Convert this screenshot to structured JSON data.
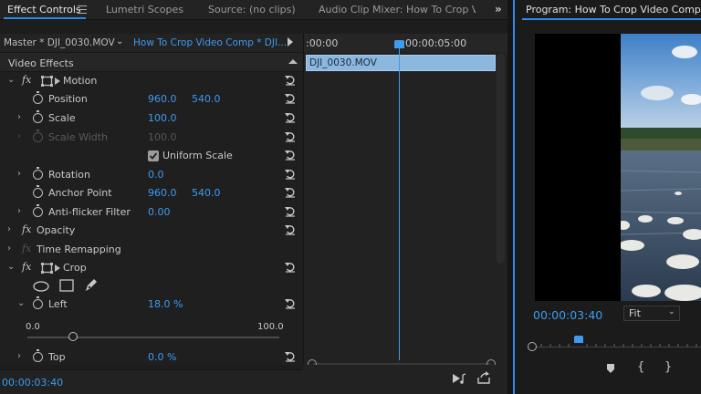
{
  "tabs": [
    {
      "label": "Effect Controls",
      "active": true
    },
    {
      "label": "Lumetri Scopes",
      "active": false
    },
    {
      "label": "Source: (no clips)",
      "active": false
    },
    {
      "label": "Audio Clip Mixer: How To Crop Video",
      "active": false
    }
  ],
  "source_row": {
    "master": "Master * DJI_0030.MOV",
    "sequence": "How To Crop Video Comp * DJI..."
  },
  "effects": {
    "header": "Video Effects",
    "motion": {
      "label": "Motion",
      "position": {
        "label": "Position",
        "x": "960.0",
        "y": "540.0"
      },
      "scale": {
        "label": "Scale",
        "value": "100.0"
      },
      "scale_width": {
        "label": "Scale Width",
        "value": "100.0"
      },
      "uniform_scale": {
        "label": "Uniform Scale",
        "checked": true
      },
      "rotation": {
        "label": "Rotation",
        "value": "0.0"
      },
      "anchor_point": {
        "label": "Anchor Point",
        "x": "960.0",
        "y": "540.0"
      },
      "anti_flicker": {
        "label": "Anti-flicker Filter",
        "value": "0.00"
      }
    },
    "opacity": {
      "label": "Opacity"
    },
    "time_remapping": {
      "label": "Time Remapping"
    },
    "crop": {
      "label": "Crop",
      "left": {
        "label": "Left",
        "value": "18.0 %",
        "slider_min": "0.0",
        "slider_max": "100.0",
        "slider_fraction": 0.18
      },
      "top": {
        "label": "Top",
        "value": "0.0 %"
      }
    }
  },
  "timecode_footer": "00:00:03:40",
  "timeline": {
    "ruler_start": ":00:00",
    "ruler_mark": "00:00:05:00",
    "clip_name": "DJI_0030.MOV"
  },
  "program": {
    "title": "Program: How To Crop Video Comp",
    "timecode": "00:00:03:40",
    "zoom": "Fit"
  },
  "colors": {
    "accent": "#2d8ceb",
    "value_blue": "#3d9bf0",
    "panel_bg": "#1f1f1f"
  }
}
